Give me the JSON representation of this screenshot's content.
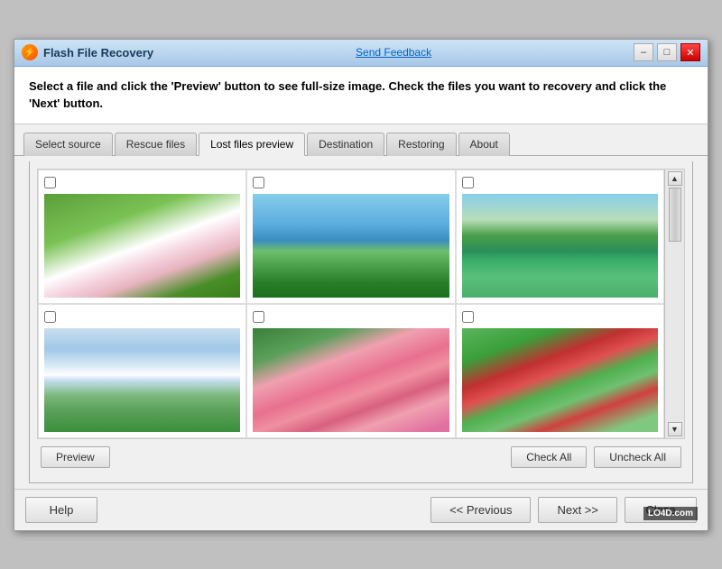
{
  "window": {
    "title": "Flash File Recovery",
    "send_feedback": "Send Feedback"
  },
  "instruction": {
    "text": "Select a file and click the 'Preview' button to see full-size image. Check the files you want to recovery and click the 'Next' button."
  },
  "tabs": [
    {
      "id": "select-source",
      "label": "Select source",
      "active": false
    },
    {
      "id": "rescue-files",
      "label": "Rescue files",
      "active": false
    },
    {
      "id": "lost-files-preview",
      "label": "Lost files preview",
      "active": true
    },
    {
      "id": "destination",
      "label": "Destination",
      "active": false
    },
    {
      "id": "restoring",
      "label": "Restoring",
      "active": false
    },
    {
      "id": "about",
      "label": "About",
      "active": false
    }
  ],
  "images": [
    {
      "id": "img1",
      "type": "flowers",
      "checked": false
    },
    {
      "id": "img2",
      "type": "river",
      "checked": false
    },
    {
      "id": "img3",
      "type": "lake-green",
      "checked": false
    },
    {
      "id": "img4",
      "type": "mountain",
      "checked": false
    },
    {
      "id": "img5",
      "type": "cherry",
      "checked": false
    },
    {
      "id": "img6",
      "type": "parrots",
      "checked": false
    }
  ],
  "buttons": {
    "preview": "Preview",
    "check_all": "Check All",
    "uncheck_all": "Uncheck All",
    "help": "Help",
    "previous": "<< Previous",
    "next": "Next >>",
    "close": "Close"
  }
}
